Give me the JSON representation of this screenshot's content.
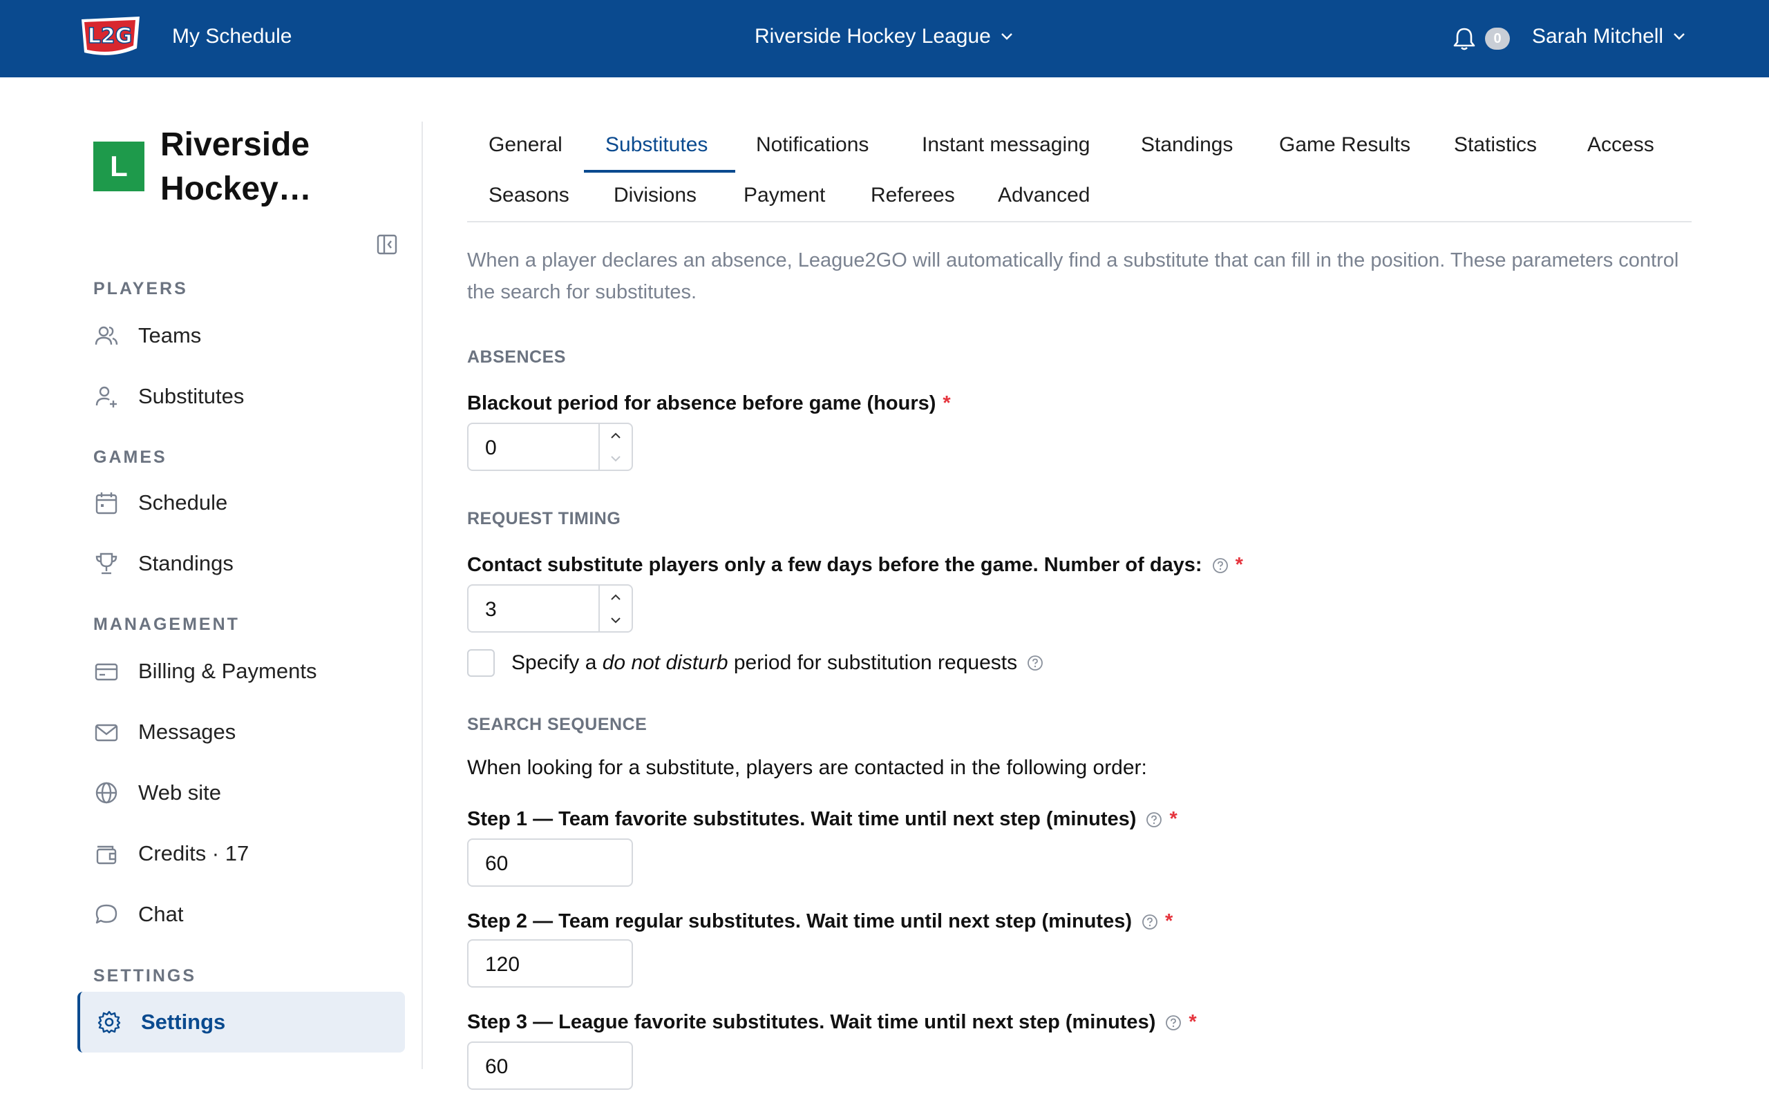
{
  "topbar": {
    "logo_text": "L2G",
    "my_schedule": "My Schedule",
    "league": "Riverside Hockey League",
    "notifications_count": "0",
    "user": "Sarah Mitchell"
  },
  "sidebar": {
    "badge": "L",
    "league_name": "Riverside Hockey…",
    "sections": {
      "players": "PLAYERS",
      "games": "GAMES",
      "management": "MANAGEMENT",
      "settings": "SETTINGS"
    },
    "items": {
      "teams": "Teams",
      "substitutes": "Substitutes",
      "schedule": "Schedule",
      "standings": "Standings",
      "billing": "Billing & Payments",
      "messages": "Messages",
      "website": "Web site",
      "credits": "Credits · 17",
      "chat": "Chat",
      "settings": "Settings"
    }
  },
  "tabs": {
    "general": "General",
    "substitutes": "Substitutes",
    "notifications": "Notifications",
    "instant_messaging": "Instant messaging",
    "standings": "Standings",
    "game_results": "Game Results",
    "statistics": "Statistics",
    "access": "Access",
    "seasons": "Seasons",
    "divisions": "Divisions",
    "payment": "Payment",
    "referees": "Referees",
    "advanced": "Advanced",
    "active": "Substitutes"
  },
  "content": {
    "intro": "When a player declares an absence, League2GO will automatically find a substitute that can fill in the position. These parameters control the search for substitutes.",
    "absences_heading": "ABSENCES",
    "blackout_label": "Blackout period for absence before game (hours)",
    "blackout_value": "0",
    "request_timing_heading": "REQUEST TIMING",
    "contact_days_label": "Contact substitute players only a few days before the game. Number of days:",
    "contact_days_value": "3",
    "dnd_prefix": "Specify a ",
    "dnd_emphasis": "do not disturb",
    "dnd_suffix": " period for substitution requests",
    "dnd_checked": false,
    "search_sequence_heading": "SEARCH SEQUENCE",
    "search_sequence_desc": "When looking for a substitute, players are contacted in the following order:",
    "step1_label": "Step 1 — Team favorite substitutes. Wait time until next step (minutes)",
    "step1_value": "60",
    "step2_label": "Step 2 — Team regular substitutes. Wait time until next step (minutes)",
    "step2_value": "120",
    "step3_label": "Step 3 — League favorite substitutes. Wait time until next step (minutes)",
    "step3_value": "60",
    "required_mark": "*"
  },
  "colors": {
    "brand": "#0a4a8f",
    "badge_green": "#1e9a4b",
    "required": "#e5343d"
  }
}
